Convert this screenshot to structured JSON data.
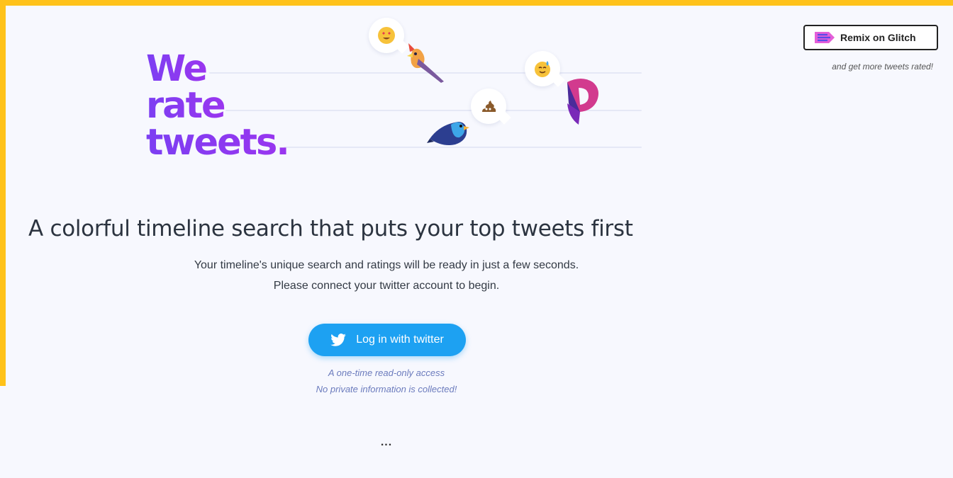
{
  "logo": {
    "lines": [
      "We",
      "rate",
      "tweets."
    ]
  },
  "remix": {
    "label": "Remix on Glitch",
    "note": "and get more tweets rated!"
  },
  "main": {
    "headline": "A colorful timeline search that puts your top tweets first",
    "subtext_line1": "Your timeline's unique search and ratings will be ready in just a few seconds.",
    "subtext_line2": "Please connect your twitter account to begin.",
    "login_label": "Log in with twitter",
    "note_line1": "A one-time read-only access",
    "note_line2": "No private information is collected!",
    "loading": "..."
  },
  "colors": {
    "brand": "#7c3ff2",
    "twitter": "#1da1f2",
    "frame": "#ffc21a"
  },
  "icons": [
    "heart-eyes-emoji-icon",
    "sweat-smile-emoji-icon",
    "poop-emoji-icon",
    "cardinal-bird-icon",
    "bluebird-icon",
    "glitch-logo-icon",
    "twitter-bird-icon",
    "glitch-fish-icon"
  ]
}
